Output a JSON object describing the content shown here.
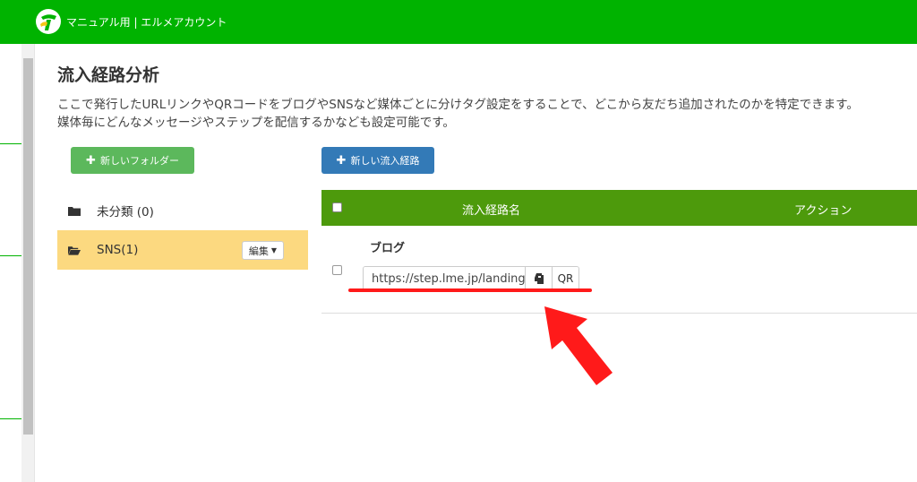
{
  "header": {
    "account_name": "マニュアル用 | エルメアカウント",
    "background_color": "#00b300"
  },
  "page": {
    "title": "流入経路分析",
    "description_line1": "ここで発行したURLリンクやQRコードをブログやSNSなど媒体ごとに分けタグ設定をすることで、どこから友だち追加されたのかを特定できます。",
    "description_line2": "媒体毎にどんなメッセージやステップを配信するかなども設定可能です。"
  },
  "toolbar": {
    "new_folder_label": "新しいフォルダー",
    "new_route_label": "新しい流入経路"
  },
  "folders": [
    {
      "label": "未分類 (0)",
      "selected": false
    },
    {
      "label": "SNS(1)",
      "selected": true,
      "edit_label": "編集"
    }
  ],
  "table": {
    "columns": [
      "流入経路名",
      "アクション"
    ],
    "rows": [
      {
        "name": "ブログ",
        "url": "https://step.lme.jp/landing",
        "qr_label": "QR"
      }
    ]
  },
  "annotation": {
    "color": "#ff1a1a"
  }
}
